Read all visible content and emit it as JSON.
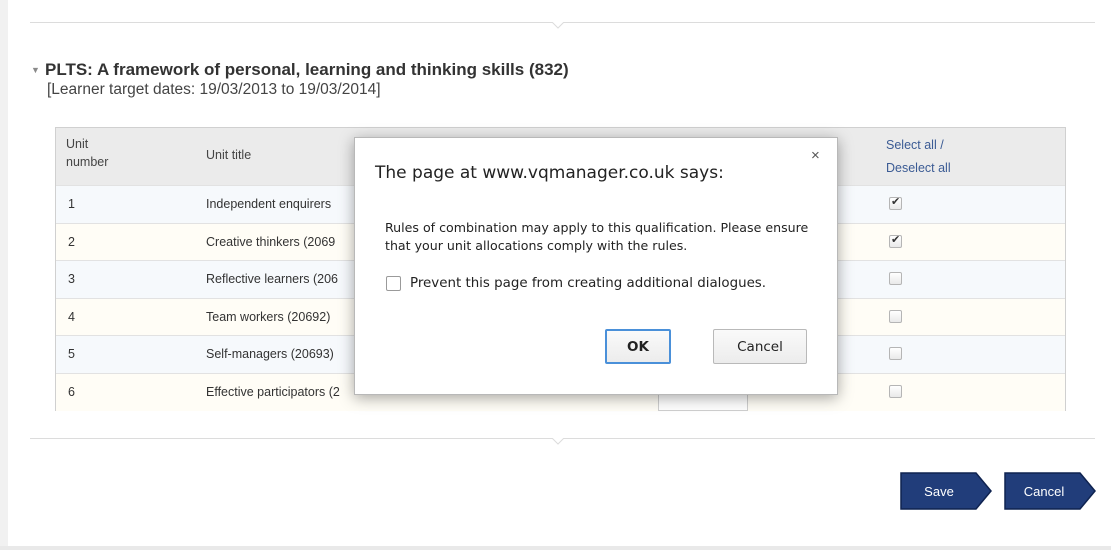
{
  "section": {
    "title": "PLTS: A framework of personal, learning and thinking skills (832)",
    "dates": "[Learner target dates: 19/03/2013 to 19/03/2014]"
  },
  "table": {
    "headers": {
      "unit_number": "Unit\nnumber",
      "unit_title": "Unit title",
      "select_all": "Select all /",
      "deselect_all": "Deselect all"
    },
    "rows": [
      {
        "number": "1",
        "title": "Independent enquirers",
        "checked": true
      },
      {
        "number": "2",
        "title": "Creative thinkers (2069",
        "checked": true
      },
      {
        "number": "3",
        "title": "Reflective learners (206",
        "checked": false
      },
      {
        "number": "4",
        "title": "Team workers (20692)",
        "checked": false
      },
      {
        "number": "5",
        "title": "Self-managers (20693)",
        "checked": false
      },
      {
        "number": "6",
        "title": "Effective participators (2",
        "checked": false
      }
    ]
  },
  "buttons": {
    "save": "Save",
    "cancel": "Cancel"
  },
  "dialog": {
    "heading": "The page at www.vqmanager.co.uk says:",
    "message": "Rules of combination may apply to this qualification. Please ensure that your unit allocations comply with the rules.",
    "checkbox_label": "Prevent this page from creating additional dialogues.",
    "ok": "OK",
    "cancel": "Cancel",
    "close": "×"
  },
  "colors": {
    "button_navy": "#213d7a",
    "focus_blue": "#4a90d9"
  }
}
